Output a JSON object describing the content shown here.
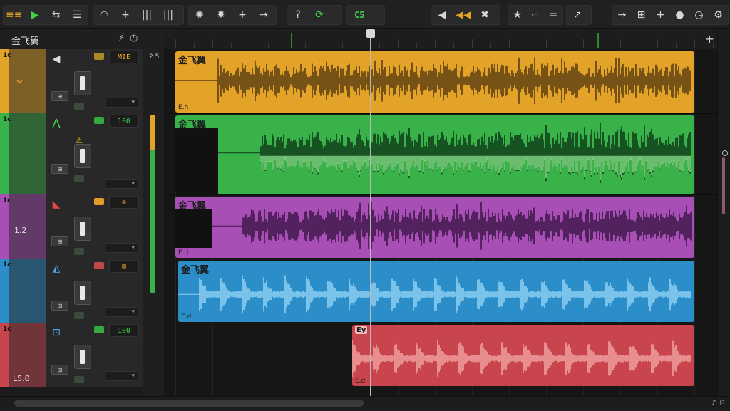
{
  "toolbar": {
    "menu_icon": "≡≡",
    "play_icon": "▶",
    "loop_icon": "⇆",
    "mixer_icon": "☰",
    "signal_icon": "◠",
    "add_icon": "+",
    "bars_icon": "|||",
    "bars2_icon": "|||",
    "settings_icon": "✺",
    "burst_icon": "✸",
    "plus_icon": "+",
    "arrows_icon": "⇢",
    "metronome_icon": "?",
    "sync_icon": "⟳",
    "cs_label": "C5",
    "rewind_icon": "◀",
    "ff_icon": "◀◀",
    "x_icon": "✖",
    "star_icon": "★",
    "cut_icon": "⌐",
    "eq_icon": "=",
    "tempo_icon": "↗",
    "fx_icon": "⇢",
    "grid_icon": "⊞",
    "plus2_icon": "+",
    "mic_icon": "●",
    "clock_icon": "◷",
    "gear_icon": "⚙"
  },
  "tracks_panel": {
    "project_name": "金飞翼",
    "dash_icon": "—",
    "bolt_icon": "⚡",
    "history_icon": "◷"
  },
  "meter": {
    "label": "2.5"
  },
  "ruler": {
    "add_track": "+"
  },
  "tracks": [
    {
      "color": "#e3a329",
      "num": "1c",
      "icon": "◀",
      "icon_color": "#ddd",
      "value": "MIE",
      "chip_color": "#a98a24",
      "fader_small": "⊞",
      "clip_name": "金飞翼",
      "clip_foot": "E.h",
      "wave_color": "#5a3e12",
      "wave_light": "",
      "extra_label": "⌄"
    },
    {
      "color": "#39b24a",
      "num": "1c",
      "icon": "⋀",
      "icon_color": "#4be05a",
      "value": "100",
      "chip_color": "#33aa3e",
      "fader_small": "⊞",
      "clip_name": "金飞翼",
      "clip_foot": "",
      "wave_color": "#0f3a18",
      "wave_light": "#8ee08e",
      "extra_label": "⚠"
    },
    {
      "color": "#a84fb5",
      "num": "1c",
      "icon": "◣",
      "icon_color": "#e04a4a",
      "value": "⊕",
      "chip_color": "#e39b28",
      "fader_small": "⊞",
      "clip_name": "金飞翼",
      "clip_foot": "E.d",
      "wave_color": "#3d1648",
      "wave_light": "",
      "extra_label": "1.2"
    },
    {
      "color": "#2b8ec9",
      "num": "1c",
      "icon": "◭",
      "icon_color": "#4aa6e8",
      "value": "⊞",
      "chip_color": "#c04848",
      "fader_small": "⊞",
      "clip_name": "金飞翼",
      "clip_foot": "E.d",
      "wave_color": "#8ed0f2",
      "wave_light": "",
      "extra_label": ""
    },
    {
      "color": "#c9454e",
      "num": "1c",
      "icon": "⊡",
      "icon_color": "#4aa6e8",
      "value": "100",
      "chip_color": "#33aa3e",
      "fader_small": "⊞",
      "clip_name": "Ey",
      "clip_foot": "E.d",
      "wave_color": "#f0a0a0",
      "wave_light": "",
      "extra_label": "L5.0"
    }
  ],
  "bottom": {
    "right_label": "♪ ⚐"
  }
}
